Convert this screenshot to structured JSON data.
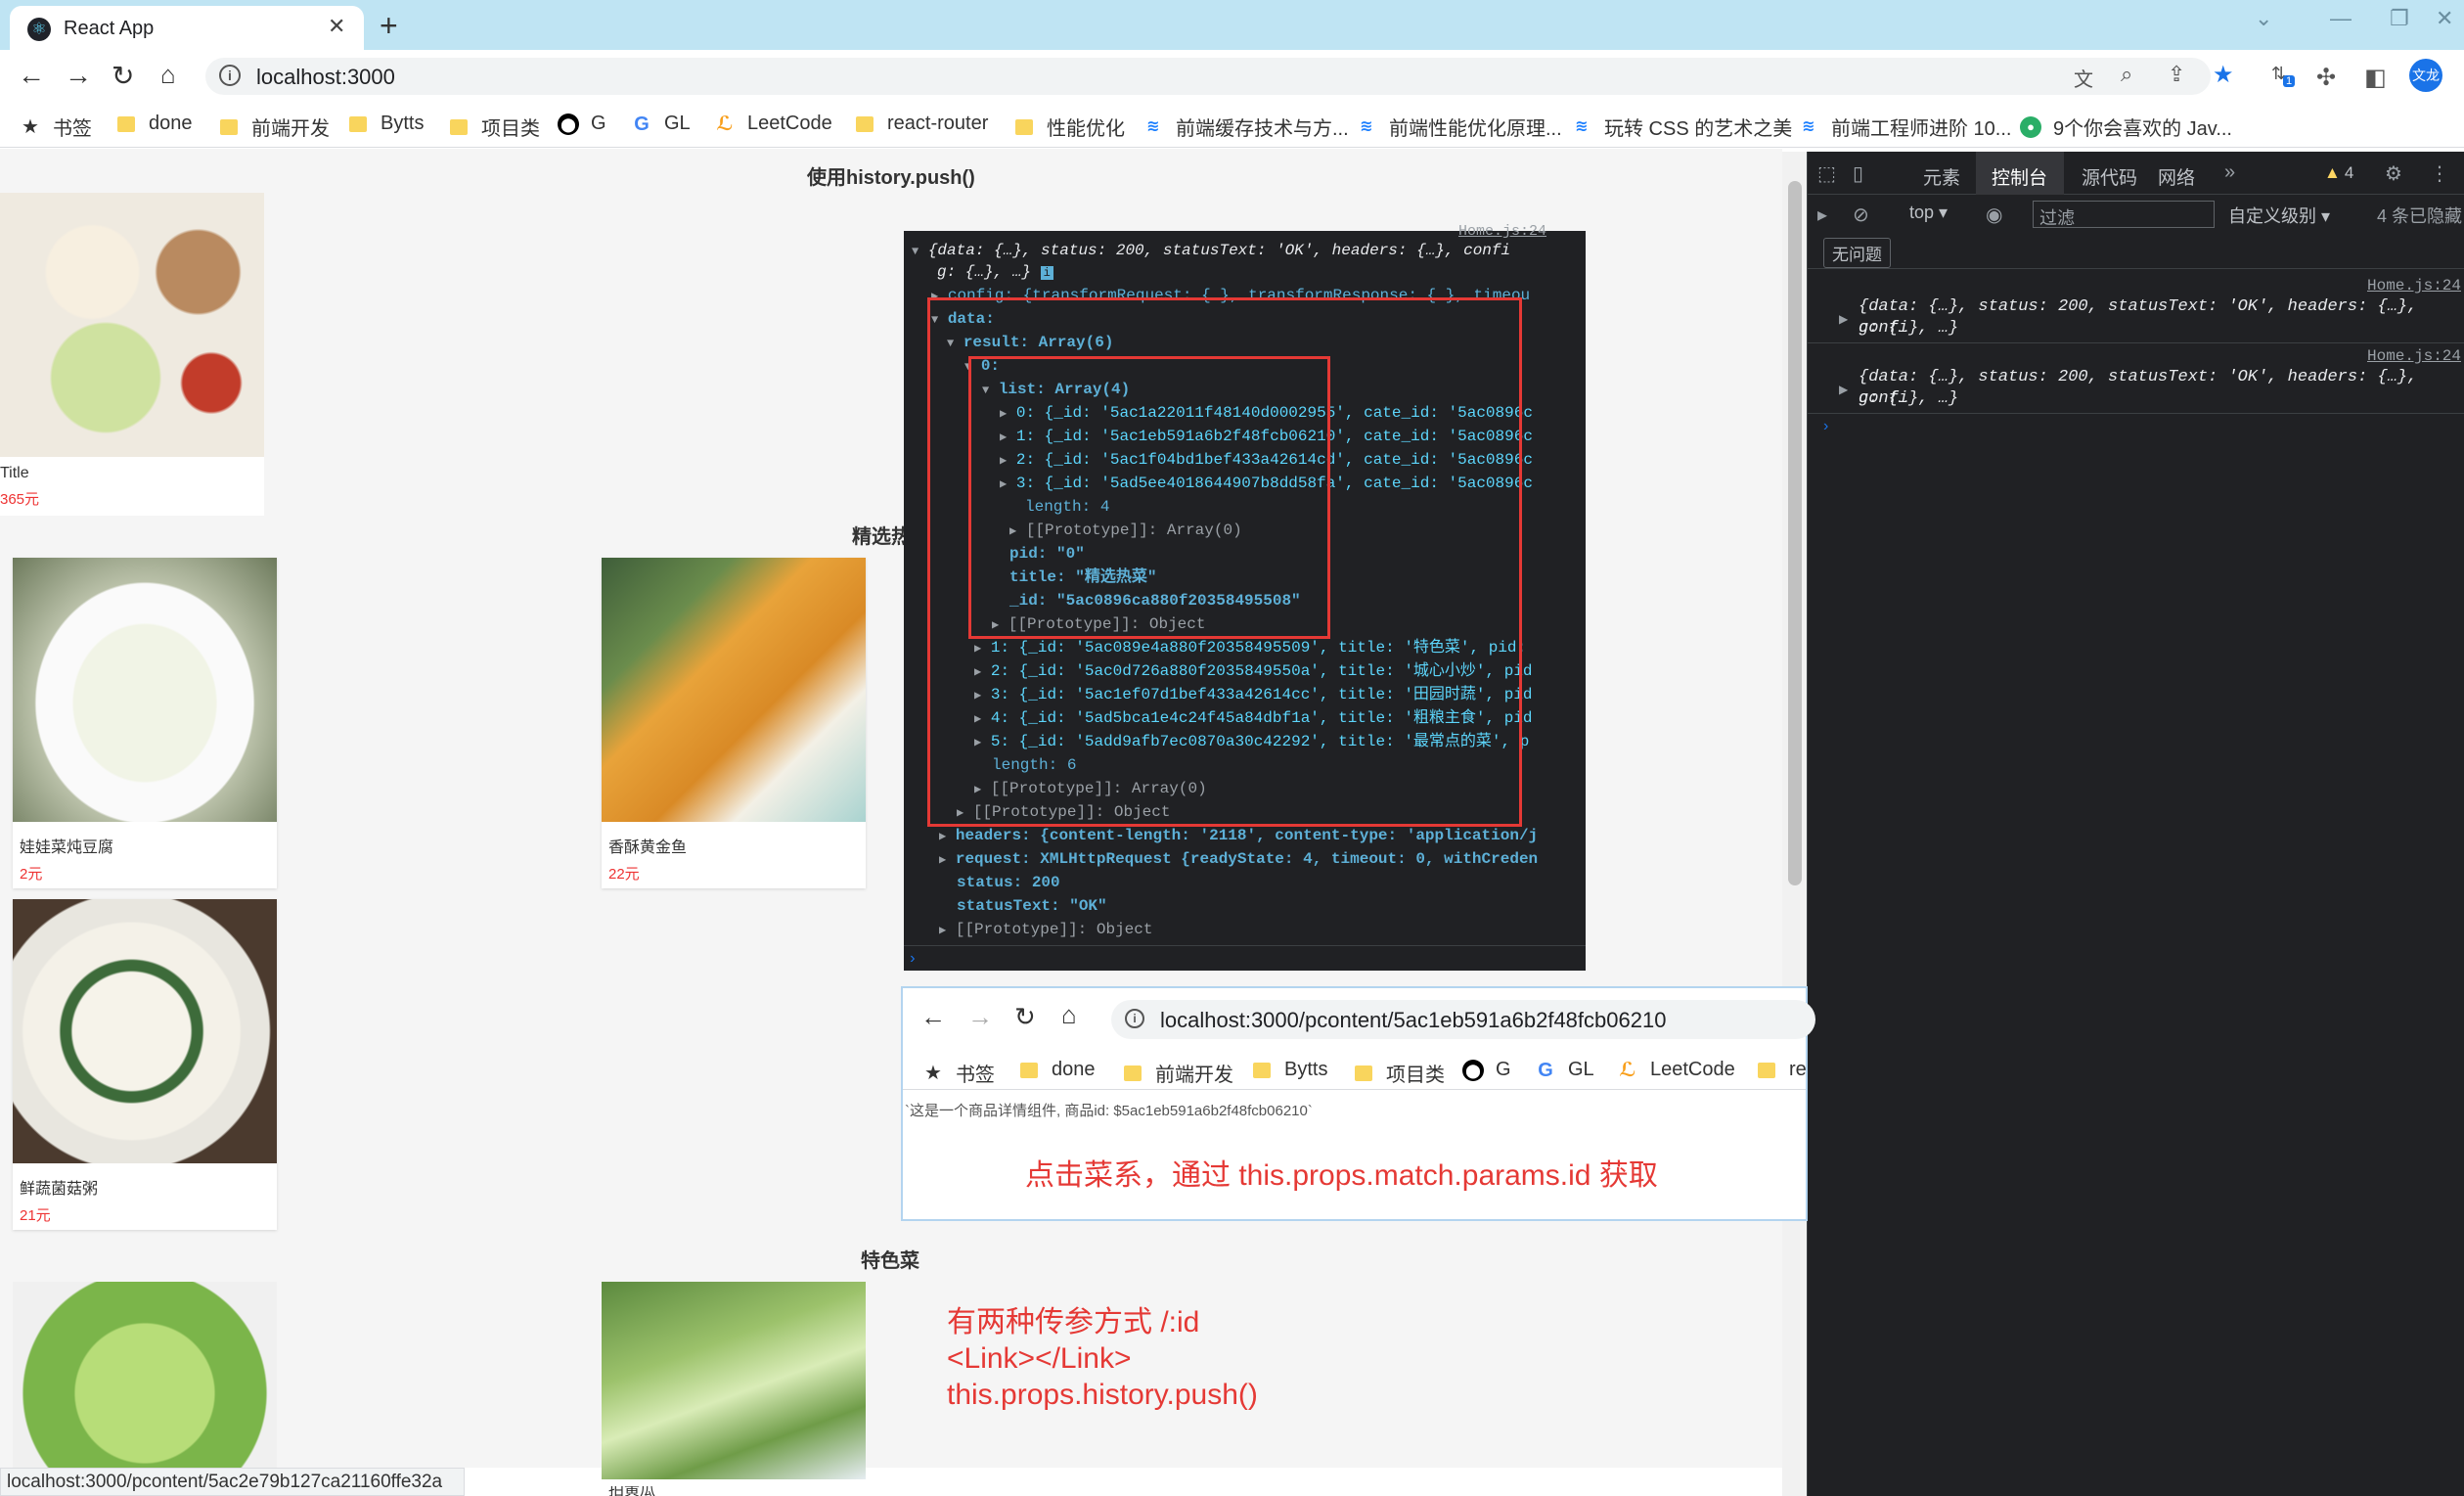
{
  "browser": {
    "tab_title": "React App",
    "url": "localhost:3000",
    "profile_label": "文龙",
    "ext_badge": "1",
    "bookmarks": [
      "书签",
      "done",
      "前端开发",
      "Bytts",
      "项目类",
      "G",
      "GL",
      "LeetCode",
      "react-router",
      "性能优化",
      "前端缓存技术与方...",
      "前端性能优化原理...",
      "玩转 CSS 的艺术之美",
      "前端工程师进阶 10...",
      "9个你会喜欢的 Jav..."
    ]
  },
  "page": {
    "section_push": "使用history.push()",
    "top_item": {
      "name": "Title",
      "price": "365元"
    },
    "section_hot": "精选热",
    "items": [
      {
        "name": "娃娃菜炖豆腐",
        "price": "2元"
      },
      {
        "name": "香酥黄金鱼",
        "price": "22元"
      },
      {
        "name": "鲜蔬菌菇粥",
        "price": "21元"
      }
    ],
    "section_special": "特色菜",
    "partial_name": "拍黄瓜"
  },
  "devtools": {
    "tabs": [
      "元素",
      "控制台",
      "源代码",
      "网络"
    ],
    "warn_count": "4",
    "context": "top",
    "filter_placeholder": "过滤",
    "level": "自定义级别",
    "hidden": "4 条已隐藏",
    "no_issues": "无问题",
    "logs": [
      {
        "src": "Home.js:24",
        "l1": "{data: {…}, status: 200, statusText: 'OK', headers: {…}, confi",
        "l2": "g: {…}, …}"
      },
      {
        "src": "Home.js:24",
        "l1": "{data: {…}, status: 200, statusText: 'OK', headers: {…}, confi",
        "l2": "g: {…}, …}"
      }
    ]
  },
  "console_popup": {
    "src": "Home.js:24",
    "lines": [
      "{data: {…}, status: 200, statusText: 'OK', headers: {…}, confi",
      "g: {…}, …}",
      "config: {transformRequest: {…}, transformResponse: {…}, timeou",
      "data:",
      "result: Array(6)",
      "0:",
      "list: Array(4)",
      "0: {_id: '5ac1a22011f48140d0002955', cate_id: '5ac0896c",
      "1: {_id: '5ac1eb591a6b2f48fcb06210', cate_id: '5ac0896c",
      "2: {_id: '5ac1f04bd1bef433a42614cd', cate_id: '5ac0896c",
      "3: {_id: '5ad5ee4018644907b8dd58fa', cate_id: '5ac0896c",
      "length: 4",
      "[[Prototype]]: Array(0)",
      "pid: \"0\"",
      "title: \"精选热菜\"",
      "_id: \"5ac0896ca880f20358495508\"",
      "[[Prototype]]: Object",
      "1: {_id: '5ac089e4a880f20358495509', title: '特色菜', pid:",
      "2: {_id: '5ac0d726a880f2035849550a', title: '城心小炒', pid",
      "3: {_id: '5ac1ef07d1bef433a42614cc', title: '田园时蔬', pid",
      "4: {_id: '5ad5bca1e4c24f45a84dbf1a', title: '粗粮主食', pid",
      "5: {_id: '5add9afb7ec0870a30c42292', title: '最常点的菜', p",
      "length: 6",
      "[[Prototype]]: Array(0)",
      "[[Prototype]]: Object",
      "headers: {content-length: '2118', content-type: 'application/j",
      "request: XMLHttpRequest {readyState: 4, timeout: 0, withCreden",
      "status: 200",
      "statusText: \"OK\"",
      "[[Prototype]]: Object"
    ]
  },
  "detail_browser": {
    "url": "localhost:3000/pcontent/5ac1eb591a6b2f48fcb06210",
    "bookmarks": [
      "书签",
      "done",
      "前端开发",
      "Bytts",
      "项目类",
      "G",
      "GL",
      "LeetCode",
      "re"
    ],
    "content": "`这是一个商品详情组件, 商品id: $5ac1eb591a6b2f48fcb06210`",
    "annotation": "点击菜系，通过 this.props.match.params.id 获取"
  },
  "notes": [
    "有两种传参方式 /:id",
    "<Link></Link>",
    "this.props.history.push()"
  ],
  "status_url": "localhost:3000/pcontent/5ac2e79b127ca21160ffe32a",
  "colors": {
    "accent": "#1a73e8",
    "annotation": "#e53935",
    "price": "#ee3333",
    "devtools_bg": "#202124"
  }
}
